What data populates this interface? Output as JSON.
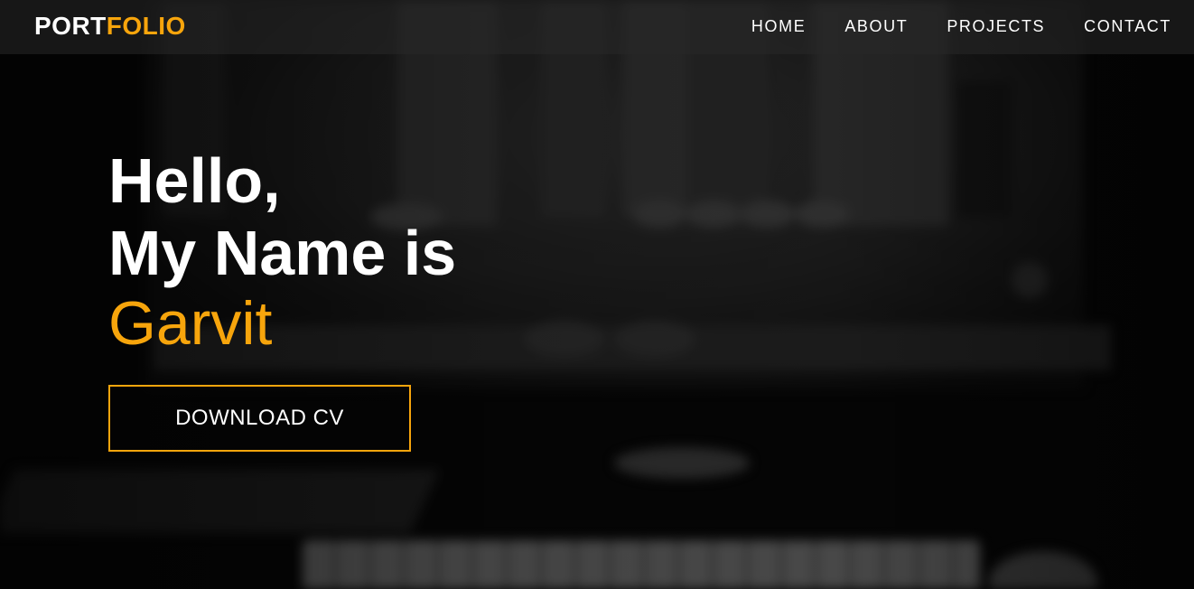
{
  "header": {
    "logo_primary": "PORT",
    "logo_accent": "FOLIO",
    "nav": [
      {
        "label": "HOME"
      },
      {
        "label": "ABOUT"
      },
      {
        "label": "PROJECTS"
      },
      {
        "label": "CONTACT"
      }
    ]
  },
  "hero": {
    "line1": "Hello,",
    "line2": "My Name is",
    "name": "Garvit",
    "cta_label": "DOWNLOAD CV"
  },
  "colors": {
    "accent": "#f7a50c",
    "text": "#ffffff",
    "background": "#060606"
  }
}
